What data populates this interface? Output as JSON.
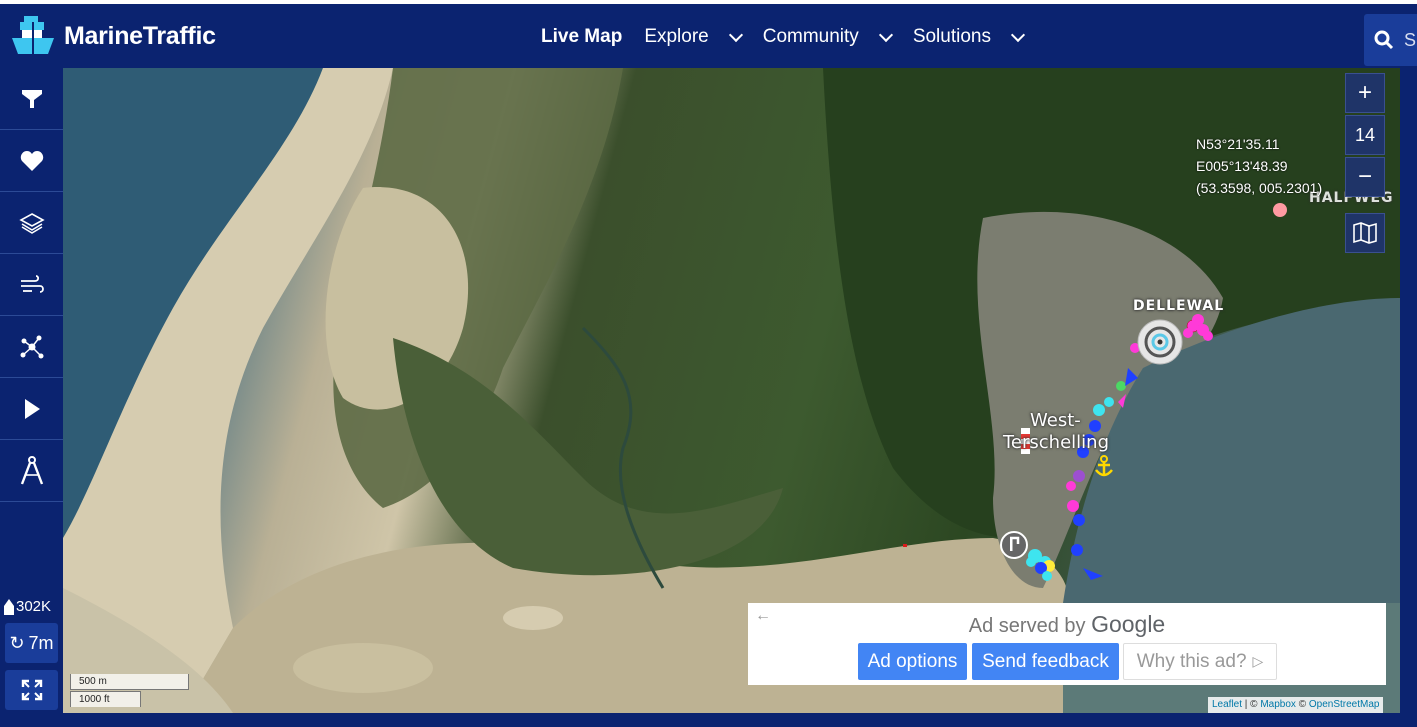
{
  "header": {
    "logo_text": "MarineTraffic",
    "nav": [
      {
        "label": "Live Map"
      },
      {
        "label": "Explore"
      },
      {
        "label": "Community"
      },
      {
        "label": "Solutions"
      }
    ],
    "search_placeholder": "S"
  },
  "sidebar": {
    "buttons": [
      {
        "name": "filter-icon"
      },
      {
        "name": "heart-icon"
      },
      {
        "name": "layers-icon"
      },
      {
        "name": "wind-icon"
      },
      {
        "name": "network-icon"
      },
      {
        "name": "play-icon"
      },
      {
        "name": "compass-icon"
      }
    ],
    "vessel_count": "302K",
    "refresh_label": "7m"
  },
  "map": {
    "zoom_in": "+",
    "zoom_level": "14",
    "zoom_out": "−",
    "coordinates": {
      "line1": "N53°21'35.11",
      "line2": "E005°13'48.39",
      "line3": "(53.3598, 005.2301)"
    },
    "labels": {
      "dellewal": "DELLEWAL",
      "halfweg": "HALFWEG",
      "town_line1": "West-",
      "town_line2": "Terschelling"
    },
    "scale": {
      "metric": "500 m",
      "imperial": "1000 ft"
    },
    "attribution": {
      "leaflet": "Leaflet",
      "mapbox": "Mapbox",
      "osm": "OpenStreetMap"
    }
  },
  "ad": {
    "served_by": "Ad served by",
    "google": "Google",
    "options": "Ad options",
    "feedback": "Send feedback",
    "why": "Why this ad?"
  },
  "colors": {
    "brand": "#0b2370",
    "accent": "#4285f4"
  }
}
